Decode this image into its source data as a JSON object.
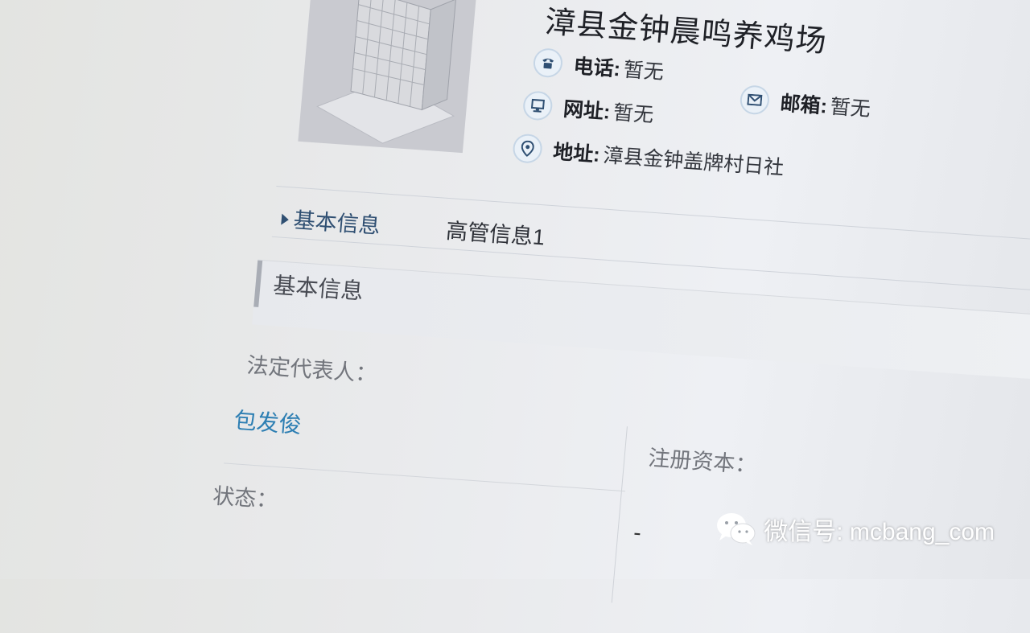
{
  "company": {
    "name": "漳县金钟晨鸣养鸡场"
  },
  "contact": {
    "phone_label": "电话:",
    "phone_value": "暂无",
    "email_label": "邮箱:",
    "email_value": "暂无",
    "website_label": "网址:",
    "website_value": "暂无",
    "address_label": "地址:",
    "address_value": "漳县金钟盖牌村日社"
  },
  "tabs": [
    {
      "label": "基本信息",
      "active": true
    },
    {
      "label": "高管信息1",
      "active": false
    }
  ],
  "section": {
    "title": "基本信息"
  },
  "fields": {
    "legal_rep_label": "法定代表人：",
    "legal_rep_value": "包发俊",
    "registered_capital_label": "注册资本：",
    "status_label": "状态：",
    "status_value": "-"
  },
  "watermark": {
    "text": "微信号: mcbang_com"
  },
  "colors": {
    "link": "#2e7fb3",
    "tab_active": "#2f4f72",
    "icon_bg": "#eaf1f8"
  },
  "icons": [
    "building-logo",
    "phone-icon",
    "email-icon",
    "website-icon",
    "location-icon",
    "wechat-icon"
  ]
}
